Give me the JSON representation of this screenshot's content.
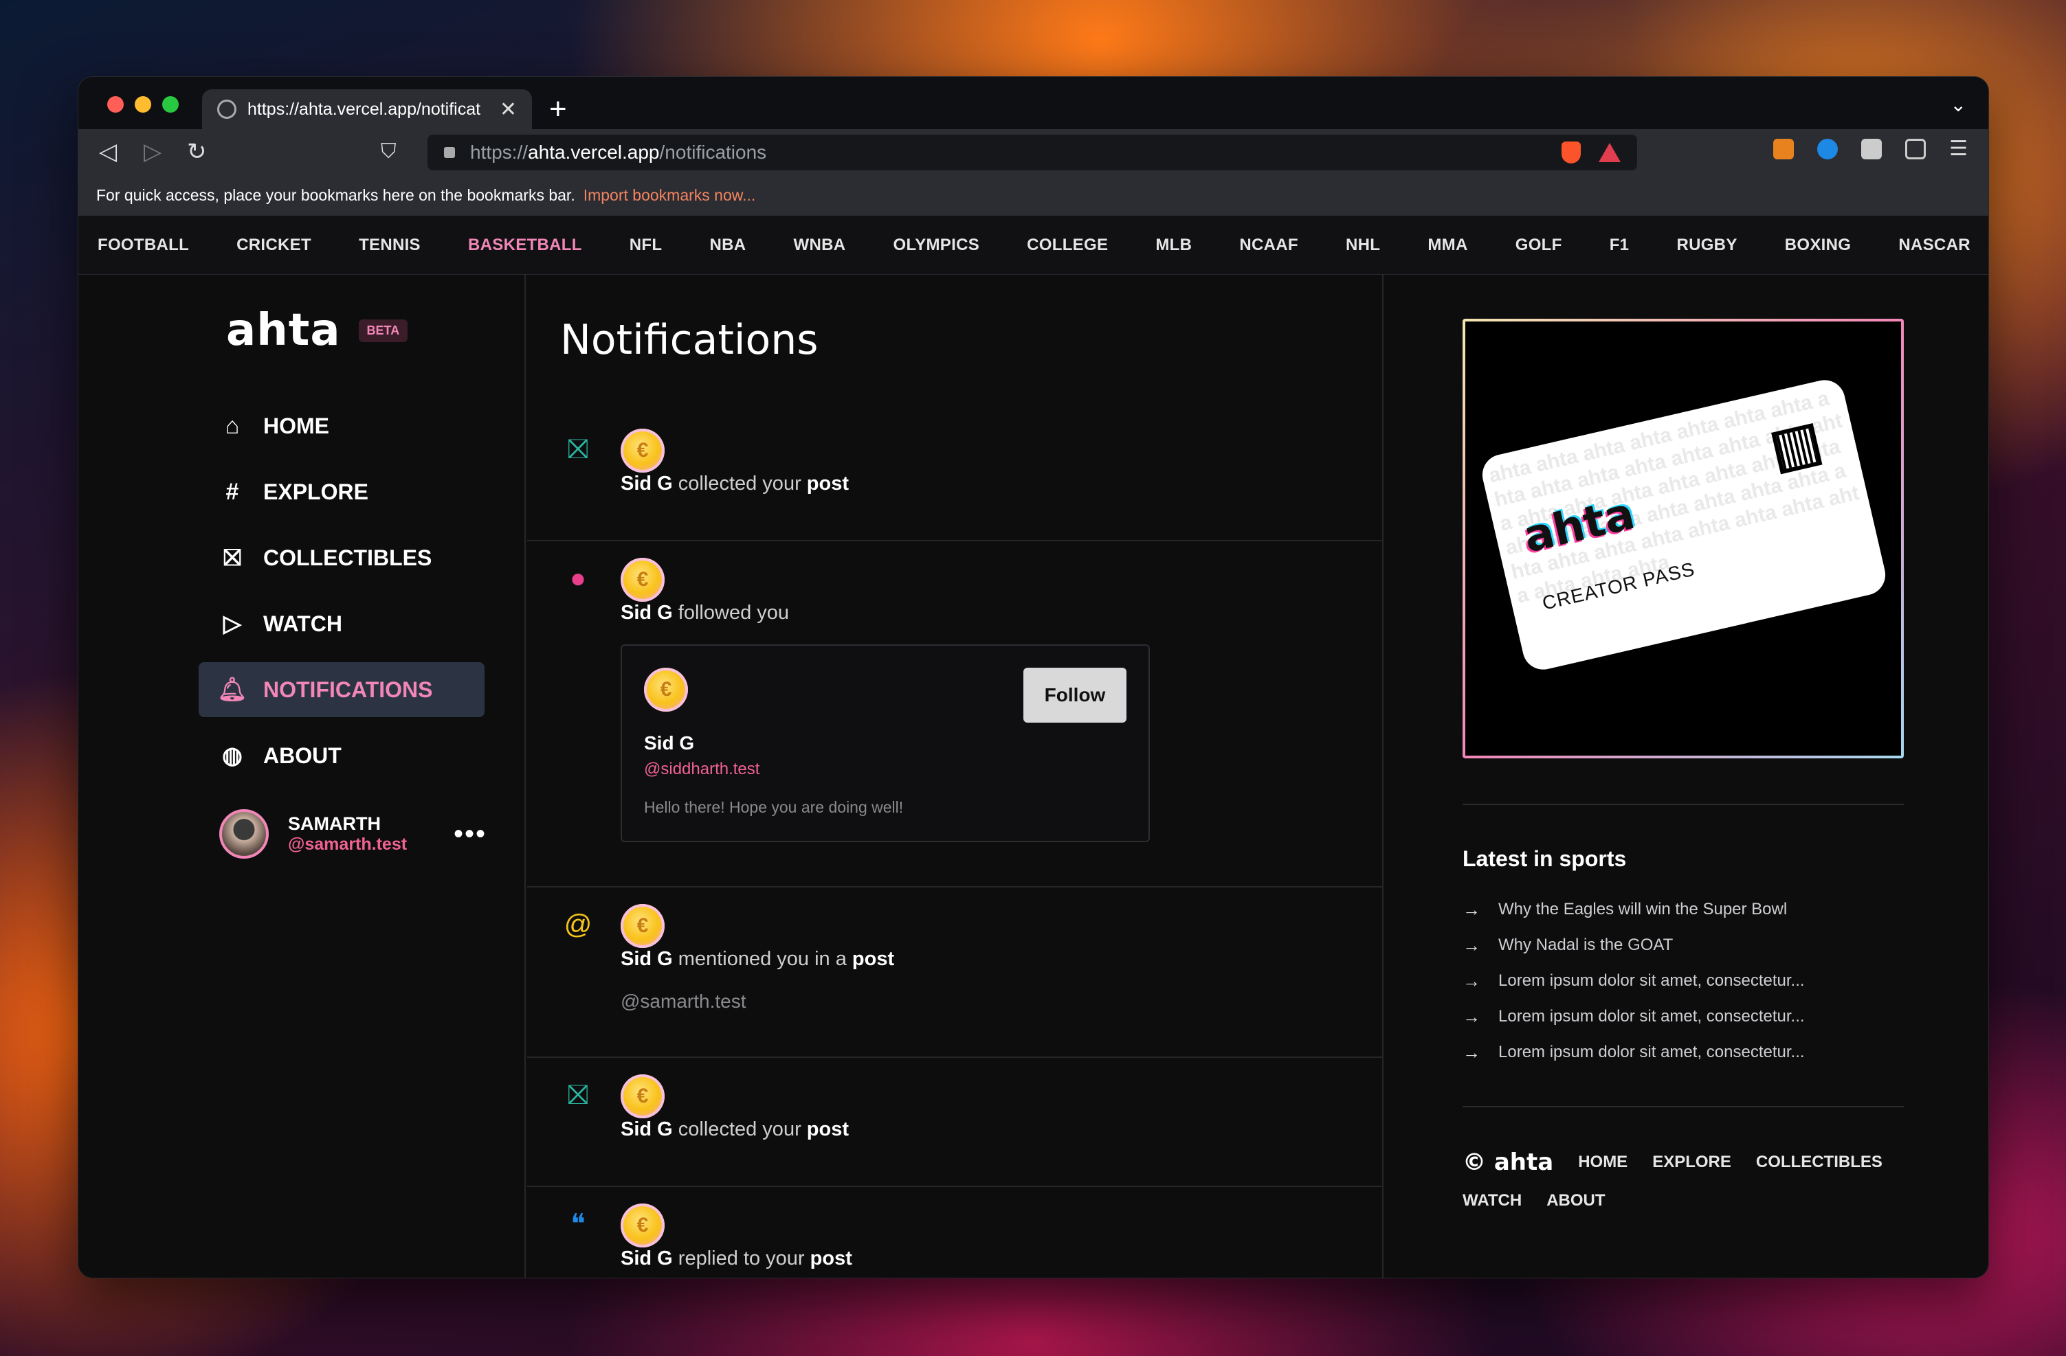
{
  "browser": {
    "tab_title": "https://ahta.vercel.app/notificat",
    "url_scheme": "https://",
    "url_host": "ahta.vercel.app",
    "url_path": "/notifications",
    "bookmark_hint": "For quick access, place your bookmarks here on the bookmarks bar.",
    "bookmark_import": "Import bookmarks now..."
  },
  "sports_nav": [
    "FOOTBALL",
    "CRICKET",
    "TENNIS",
    "BASKETBALL",
    "NFL",
    "NBA",
    "WNBA",
    "OLYMPICS",
    "COLLEGE",
    "MLB",
    "NCAAF",
    "NHL",
    "MMA",
    "GOLF",
    "F1",
    "RUGBY",
    "BOXING",
    "NASCAR"
  ],
  "sports_active": "BASKETBALL",
  "sidebar": {
    "logo": "ahta",
    "beta": "BETA",
    "items": [
      {
        "label": "HOME",
        "icon": "home-icon"
      },
      {
        "label": "EXPLORE",
        "icon": "hash-icon"
      },
      {
        "label": "COLLECTIBLES",
        "icon": "gift-icon"
      },
      {
        "label": "WATCH",
        "icon": "play-icon"
      },
      {
        "label": "NOTIFICATIONS",
        "icon": "bell-icon"
      },
      {
        "label": "ABOUT",
        "icon": "globe-icon"
      }
    ],
    "active": "NOTIFICATIONS",
    "user": {
      "name": "SAMARTH",
      "handle": "@samarth.test"
    }
  },
  "main": {
    "title": "Notifications",
    "notifications": [
      {
        "icon": "gift-icon",
        "actor": "Sid G",
        "text": "collected your",
        "target": "post"
      },
      {
        "icon": "user-icon",
        "actor": "Sid G",
        "text": "followed you",
        "target": ""
      },
      {
        "icon": "at-icon",
        "actor": "Sid G",
        "text": "mentioned you in a",
        "target": "post",
        "mention": "@samarth.test"
      },
      {
        "icon": "gift-icon",
        "actor": "Sid G",
        "text": "collected your",
        "target": "post"
      },
      {
        "icon": "chat-icon",
        "actor": "Sid G",
        "text": "replied to your",
        "target": "post"
      }
    ],
    "follow_card": {
      "name": "Sid G",
      "handle": "@siddharth.test",
      "bio": "Hello there! Hope you are doing well!",
      "button": "Follow"
    }
  },
  "right": {
    "pass_brand": "ahta",
    "pass_label": "CREATOR PASS",
    "latest_title": "Latest in sports",
    "latest": [
      "Why the Eagles will win the Super Bowl",
      "Why Nadal is the GOAT",
      "Lorem ipsum dolor sit amet, consectetur...",
      "Lorem ipsum dolor sit amet, consectetur...",
      "Lorem ipsum dolor sit amet, consectetur..."
    ],
    "footer_brand": "© ahta",
    "footer_links": [
      "HOME",
      "EXPLORE",
      "COLLECTIBLES",
      "WATCH",
      "ABOUT"
    ]
  },
  "colors": {
    "accent": "#f287b7",
    "handle": "#f06292",
    "active_bg": "#2c3444"
  }
}
